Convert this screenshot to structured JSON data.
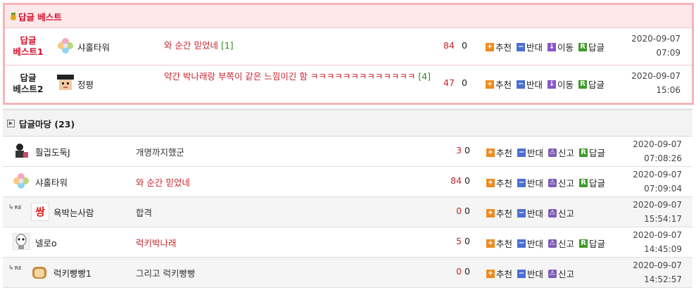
{
  "best": {
    "title": "답글 베스트",
    "rows": [
      {
        "rank_line1": "답글",
        "rank_line2": "베스트1",
        "nick": "샤홀타워",
        "title": "와 순간 믿었네",
        "comments": "[1]",
        "recommend": "84",
        "oppose": "0",
        "actions": {
          "recommend": "추천",
          "oppose": "반대",
          "move": "이동",
          "reply": "답글"
        },
        "date": "2020-09-07",
        "time": "07:09"
      },
      {
        "rank_line1": "답글",
        "rank_line2": "베스트2",
        "nick": "정평",
        "title": "약간 박나래랑 부쪽이 같은 느낌이긴 함 ㅋㅋㅋㅋㅋㅋㅋㅋㅋㅋㅋㅋㅋ",
        "comments": "[4]",
        "recommend": "47",
        "oppose": "0",
        "actions": {
          "recommend": "추천",
          "oppose": "반대",
          "move": "이동",
          "reply": "답글"
        },
        "date": "2020-09-07",
        "time": "15:06"
      }
    ]
  },
  "board": {
    "title": "답글마당 (23)",
    "rows": [
      {
        "re": "",
        "nick": "훨긥도둑J",
        "title": "개명까지했군",
        "recommend": "3",
        "oppose": "0",
        "a1": "추천",
        "a2": "반대",
        "a3": "신고",
        "a4": "답글",
        "date": "2020-09-07",
        "time": "07:08:26"
      },
      {
        "re": "",
        "nick": "샤홀타워",
        "title": "와 순간 믿었네",
        "recommend": "84",
        "oppose": "0",
        "a1": "추천",
        "a2": "반대",
        "a3": "신고",
        "a4": "답글",
        "date": "2020-09-07",
        "time": "07:09:04"
      },
      {
        "re": "RE",
        "nick": "욕박는사람",
        "title": "합격",
        "recommend": "0",
        "oppose": "0",
        "a1": "추천",
        "a2": "반대",
        "a3": "신고",
        "a4": "",
        "date": "2020-09-07",
        "time": "15:54:17"
      },
      {
        "re": "",
        "nick": "넬로o",
        "title": "럭키박나래",
        "recommend": "5",
        "oppose": "0",
        "a1": "추천",
        "a2": "반대",
        "a3": "신고",
        "a4": "답글",
        "date": "2020-09-07",
        "time": "14:45:09"
      },
      {
        "re": "RE",
        "nick": "럭키빵빵1",
        "title": "그리고 럭키빵빵",
        "recommend": "0",
        "oppose": "0",
        "a1": "추천",
        "a2": "반대",
        "a3": "신고",
        "a4": "",
        "date": "2020-09-07",
        "time": "14:52:57"
      }
    ]
  },
  "avatar_text": {
    "ssang": "쌍"
  },
  "colors": {
    "best_border": "#f6b3b8",
    "best_head_bg": "#fde8ea",
    "accent_red": "#c8232c",
    "count_green": "#2e8b1a"
  }
}
